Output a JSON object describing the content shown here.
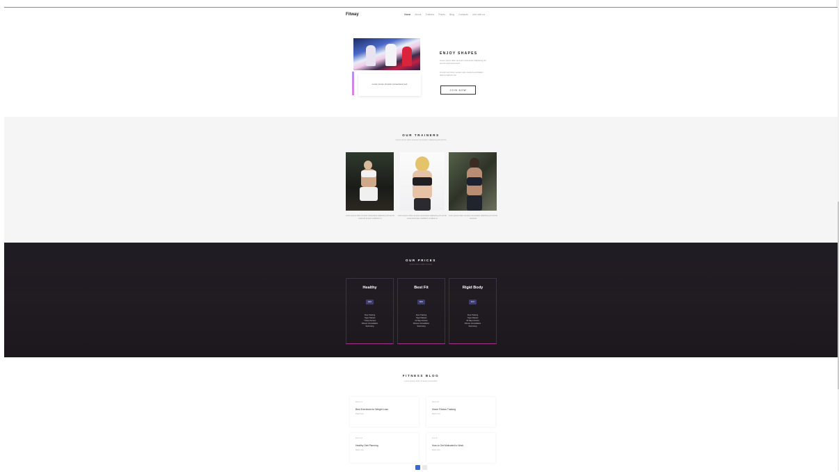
{
  "header": {
    "logo": "Fitway",
    "nav": [
      "Home",
      "About",
      "Trainers",
      "Prices",
      "Blog",
      "Contacts",
      "Join with us"
    ]
  },
  "intro": {
    "card_text": "Lorem ipsum sit dolor consectetur text",
    "title": "ENJOY SHAPES",
    "paragraph_1": "Lorem ipsum dolor sit amet consectetur adipiscing elit sed do eiusmod tempor.",
    "paragraph_2": "Ut enim ad minim veniam quis nostrud exercitation ullamco laboris nisi.",
    "button": "JOIN NOW"
  },
  "trainers": {
    "title": "OUR TRAINERS",
    "subtitle": "Lorem ipsum dolor sit amet consectetur adipiscing elit sed do",
    "items": [
      {
        "caption": "Lorem ipsum dolor sit amet consectetur adipiscing elit sed do eiusmod tempor incididunt ut"
      },
      {
        "caption": "Lorem ipsum dolor sit amet consectetur adipiscing elit sed do eiusmod tempor incididunt ut labore et"
      },
      {
        "caption": "Lorem ipsum dolor sit amet consectetur adipiscing elit sed do eiusmod"
      }
    ]
  },
  "prices": {
    "title": "OUR PRICES",
    "subtitle": "Lorem ipsum dolor sit amet",
    "plans": [
      {
        "name": "Healthy",
        "price": "$30",
        "features": [
          "Free Training",
          "Yoga Classes",
          "7 Days Access",
          "Fitness Consultation",
          "Swimming"
        ]
      },
      {
        "name": "Best Fit",
        "price": "$50",
        "features": [
          "Free Training",
          "Yoga Classes",
          "14 Days Access",
          "Fitness Consultation",
          "Swimming"
        ]
      },
      {
        "name": "Rigid Body",
        "price": "$70",
        "features": [
          "Free Training",
          "Yoga Classes",
          "30 Days Access",
          "Fitness Consultation",
          "Swimming"
        ]
      }
    ]
  },
  "blog": {
    "title": "FITNESS BLOG",
    "subtitle": "Lorem ipsum dolor sit amet consectetur",
    "posts": [
      {
        "date": "March 12",
        "title": "Best Exercises for Weight Loss",
        "more": "Read more"
      },
      {
        "date": "March 08",
        "title": "Home Fitness Training",
        "more": "Read more"
      },
      {
        "date": "March 02",
        "title": "Healthy Diet Planning",
        "more": "Read more"
      },
      {
        "date": "Feb 26",
        "title": "How to Get Motivated to Work",
        "more": "Read more"
      }
    ],
    "pages": [
      "1",
      "2"
    ]
  },
  "colors": {
    "accent": "#2b6fd6",
    "dark": "#1f1c23",
    "plan_price": "#3e3d6f",
    "plan_border": "#a2338e"
  }
}
